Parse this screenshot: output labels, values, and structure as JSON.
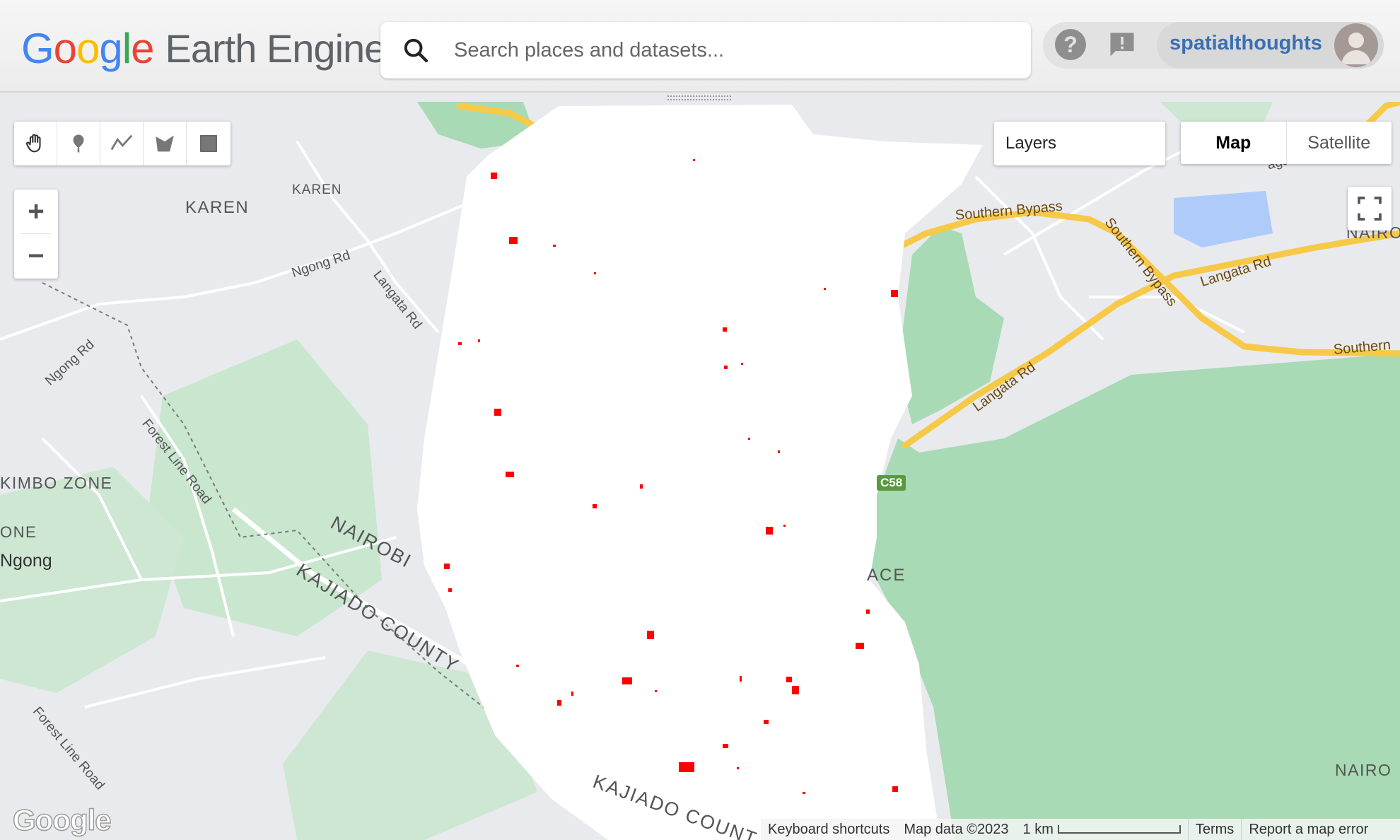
{
  "header": {
    "logo_google": [
      "G",
      "o",
      "o",
      "g",
      "l",
      "e"
    ],
    "logo_rest": "Earth Engine",
    "search_placeholder": "Search places and datasets...",
    "help_label": "?",
    "username": "spatialthoughts"
  },
  "map": {
    "toolbar": [
      "pan-hand",
      "point",
      "line",
      "polygon",
      "rectangle"
    ],
    "zoom_in": "+",
    "zoom_out": "−",
    "layers_label": "Layers",
    "map_type": {
      "options": [
        "Map",
        "Satellite"
      ],
      "selected": "Map"
    },
    "labels": {
      "karen_small": "KAREN",
      "karen": "KAREN",
      "ngong_rd_1": "Ngong Rd",
      "ngong_rd_2": "Ngong Rd",
      "langata_rd_1": "Langata Rd",
      "southern_bypass_1": "Southern Bypass",
      "southern_bypass_2": "Southern Bypass",
      "langata_rd_2": "Langata Rd",
      "langata_rd_3": "Langata Rd",
      "southern": "Southern",
      "ngathi_way": "agathi Way",
      "nairo_top": "NAIRO",
      "kimbo_zone": "KIMBO ZONE",
      "one": "ONE",
      "ngong": "Ngong",
      "forest_line_1": "Forest Line Road",
      "forest_line_2": "Forest Line Road",
      "nairobi": "NAIROBI",
      "kajiado_1": "KAJIADO COUNTY",
      "kajiado_2": "KAJIADO COUNT",
      "ace": "ACE",
      "c58": "C58",
      "nairo_bottom": "NAIRO"
    },
    "watermark": "Google",
    "attribution": {
      "keyboard": "Keyboard shortcuts",
      "map_data": "Map data ©2023",
      "scale": "1 km",
      "terms": "Terms",
      "report": "Report a map error"
    },
    "colors": {
      "park": "#a8dab5",
      "road_major": "#f7c948",
      "road_minor": "#ffffff",
      "base": "#e9eaed",
      "detection": "#ff0000",
      "mask": "#ffffff"
    }
  }
}
